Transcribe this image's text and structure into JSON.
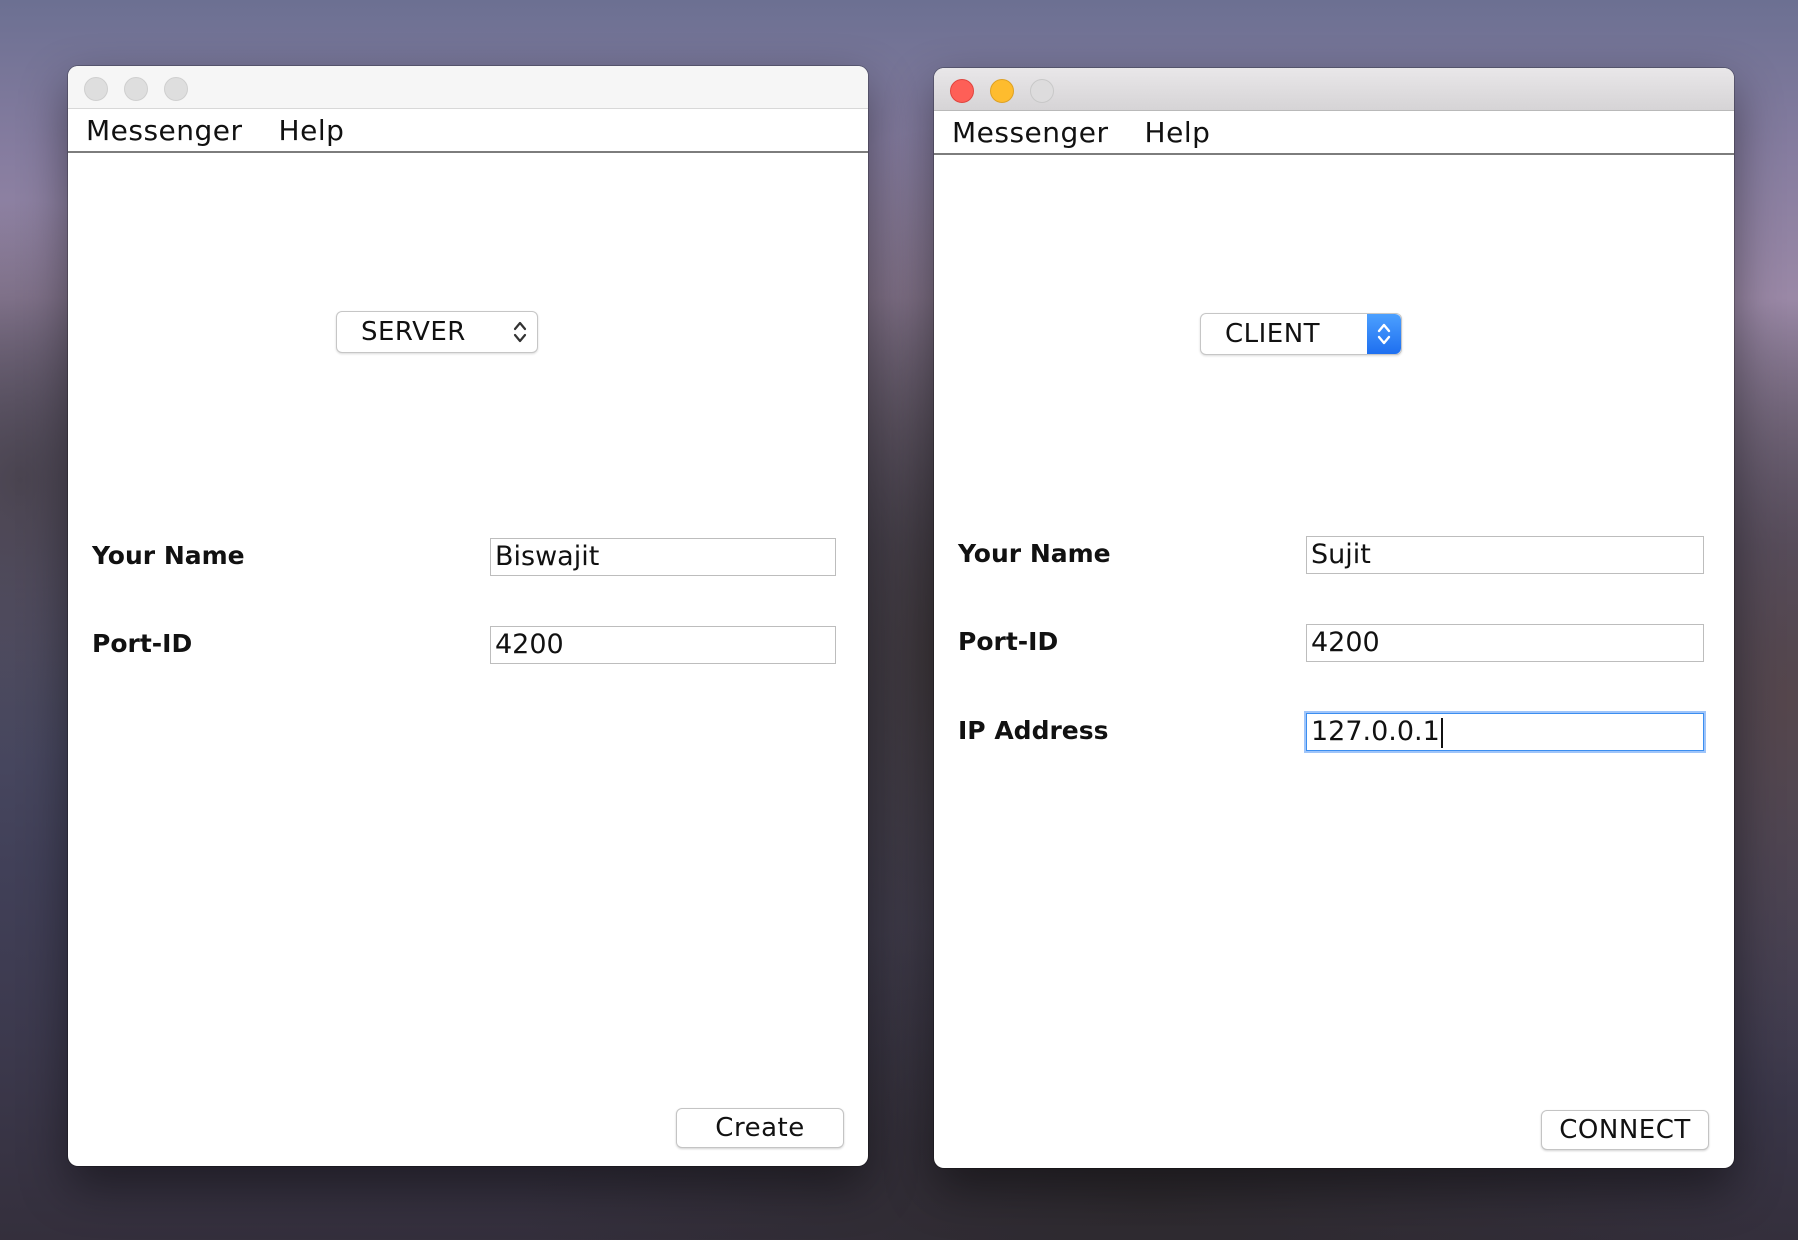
{
  "server_window": {
    "menu": [
      "Messenger",
      "Help"
    ],
    "role_select": {
      "value": "SERVER"
    },
    "fields": {
      "name_label": "Your Name",
      "name_value": "Biswajit",
      "port_label": "Port-ID",
      "port_value": "4200"
    },
    "action_button": "Create"
  },
  "client_window": {
    "menu": [
      "Messenger",
      "Help"
    ],
    "role_select": {
      "value": "CLIENT"
    },
    "fields": {
      "name_label": "Your Name",
      "name_value": "Sujit",
      "port_label": "Port-ID",
      "port_value": "4200",
      "ip_label": "IP Address",
      "ip_value": "127.0.0.1"
    },
    "action_button": "CONNECT"
  },
  "icons": {
    "traffic_lights_inactive": [
      "close-icon",
      "minimize-icon",
      "zoom-icon"
    ],
    "traffic_lights_active": [
      "close-icon",
      "minimize-icon",
      "zoom-icon"
    ],
    "select_arrows": "chevron-up-down-icon"
  },
  "colors": {
    "close_red": "#fe5f57",
    "minimize_yellow": "#febc2e",
    "focus_blue": "#3b8ef0",
    "select_accent_blue": "#1e6ff0"
  }
}
